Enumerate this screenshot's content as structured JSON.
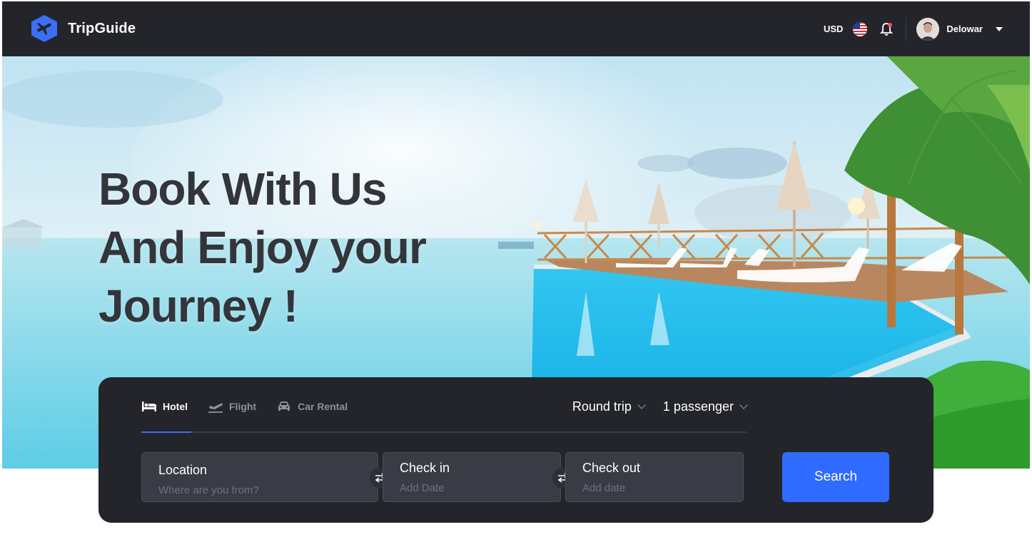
{
  "nav": {
    "brand": "TripGuide",
    "currency": "USD",
    "user_name": "Delowar",
    "icons": [
      "brand-logo-icon",
      "us-flag-icon",
      "bell-icon",
      "avatar",
      "caret-down-icon"
    ]
  },
  "hero": {
    "headline_lines": [
      "Book With Us",
      "And Enjoy your",
      "Journey !"
    ]
  },
  "search": {
    "tabs": [
      {
        "label": "Hotel",
        "icon": "bed-icon",
        "active": true
      },
      {
        "label": "Flight",
        "icon": "plane-icon",
        "active": false
      },
      {
        "label": "Car Rental",
        "icon": "car-icon",
        "active": false
      }
    ],
    "trip_type": "Round trip",
    "passengers": "1 passenger",
    "location": {
      "label": "Location",
      "placeholder": "Where are you from?"
    },
    "check_in": {
      "label": "Check in",
      "placeholder": "Add Date"
    },
    "check_out": {
      "label": "Check out",
      "placeholder": "Add date"
    },
    "button": "Search"
  },
  "colors": {
    "nav_bg": "#23252b",
    "accent": "#2f6bff",
    "headline": "#33353b"
  }
}
